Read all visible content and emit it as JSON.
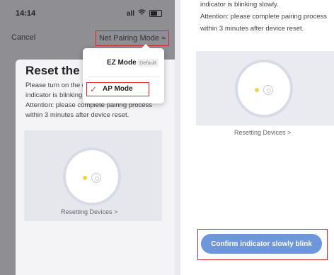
{
  "left": {
    "status_time": "14:14",
    "status_signal": "all",
    "nav": {
      "cancel_label": "Cancel",
      "mode_label": "Net Pairing Mode",
      "mode_icon": "≈"
    },
    "card": {
      "title": "Reset the de",
      "desc_line1": "Please turn on the d",
      "desc_line2": "indicator is blinking",
      "desc_line3": "Attention: please complete pairing process",
      "desc_line4": "within 3 minutes after device reset.",
      "resetting_link": "Resetting Devices >"
    },
    "dropdown": {
      "ez_label": "EZ Mode",
      "ez_badge": "Default",
      "ap_label": "AP Mode",
      "ap_check": "✓"
    }
  },
  "right": {
    "desc_line1": "indicator is blinking slowly.",
    "desc_line2": "Attention: please complete pairing process",
    "desc_line3": "within 3 minutes after device reset.",
    "resetting_link": "Resetting Devices >",
    "confirm_label": "Confirm indicator slowly blink"
  },
  "colors": {
    "highlight_red": "#d8262b",
    "accent_blue": "#6d96db",
    "led_yellow": "#f2d14b"
  }
}
